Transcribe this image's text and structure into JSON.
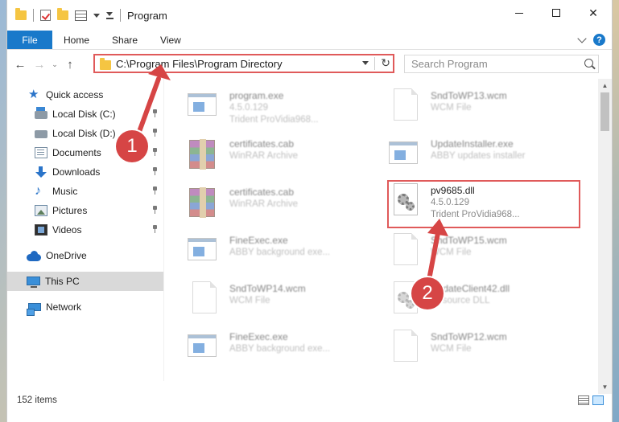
{
  "window": {
    "title": "Program",
    "minimize_glyph": "",
    "maximize_glyph": "",
    "close_glyph": "✕"
  },
  "ribbon": {
    "tabs": [
      {
        "label": "File",
        "active": true
      },
      {
        "label": "Home"
      },
      {
        "label": "Share"
      },
      {
        "label": "View"
      }
    ],
    "help_glyph": "?",
    "accent_color": "#1979ca"
  },
  "nav": {
    "back_glyph": "←",
    "forward_glyph": "→",
    "recent_glyph": "⌄",
    "up_glyph": "↑",
    "address": "C:\\Program Files\\Program Directory",
    "refresh_glyph": "↻",
    "search_placeholder": "Search Program"
  },
  "sidebar": {
    "items": [
      {
        "label": "Quick access",
        "icon": "star-icon"
      },
      {
        "label": "Local Disk (C:)",
        "icon": "disk-icon",
        "pinned": true
      },
      {
        "label": "Local Disk (D:)",
        "icon": "disk-icon",
        "pinned": true
      },
      {
        "label": "Documents",
        "icon": "documents-icon",
        "pinned": true
      },
      {
        "label": "Downloads",
        "icon": "downloads-icon",
        "pinned": true
      },
      {
        "label": "Music",
        "icon": "music-icon",
        "pinned": true
      },
      {
        "label": "Pictures",
        "icon": "pictures-icon",
        "pinned": true
      },
      {
        "label": "Videos",
        "icon": "videos-icon",
        "pinned": true
      },
      {
        "label": "OneDrive",
        "icon": "onedrive-icon"
      },
      {
        "label": "This PC",
        "icon": "this-pc-icon",
        "selected": true
      },
      {
        "label": "Network",
        "icon": "network-icon"
      }
    ]
  },
  "files": [
    {
      "name": "program.exe",
      "line2": "4.5.0.129",
      "line3": "Trident ProVidia968...",
      "icon": "exe-icon"
    },
    {
      "name": "SndToWP13.wcm",
      "line2": "WCM File",
      "line3": "",
      "icon": "blank-file-icon"
    },
    {
      "name": "certificates.cab",
      "line2": "WinRAR Archive",
      "line3": "",
      "icon": "winrar-icon"
    },
    {
      "name": "UpdateInstaller.exe",
      "line2": "ABBY updates installer",
      "line3": "",
      "icon": "exe-icon"
    },
    {
      "name": "certificates.cab",
      "line2": "WinRAR Archive",
      "line3": "",
      "icon": "winrar-icon"
    },
    {
      "name": "pv9685.dll",
      "line2": "4.5.0.129",
      "line3": "Trident ProVidia968...",
      "icon": "dll-icon",
      "highlighted": true
    },
    {
      "name": "FineExec.exe",
      "line2": "ABBY background exe...",
      "line3": "",
      "icon": "exe-icon"
    },
    {
      "name": "SndToWP15.wcm",
      "line2": "WCM File",
      "line3": "",
      "icon": "blank-file-icon"
    },
    {
      "name": "SndToWP14.wcm",
      "line2": "WCM File",
      "line3": "",
      "icon": "blank-file-icon"
    },
    {
      "name": "UpdateClient42.dll",
      "line2": "Resource DLL",
      "line3": "",
      "icon": "dll-icon"
    },
    {
      "name": "FineExec.exe",
      "line2": "ABBY background exe...",
      "line3": "",
      "icon": "exe-icon"
    },
    {
      "name": "SndToWP12.wcm",
      "line2": "WCM File",
      "line3": "",
      "icon": "blank-file-icon"
    }
  ],
  "status": {
    "item_count": "152 items"
  },
  "annotations": {
    "step1": "1",
    "step2": "2",
    "color": "#d64545"
  }
}
